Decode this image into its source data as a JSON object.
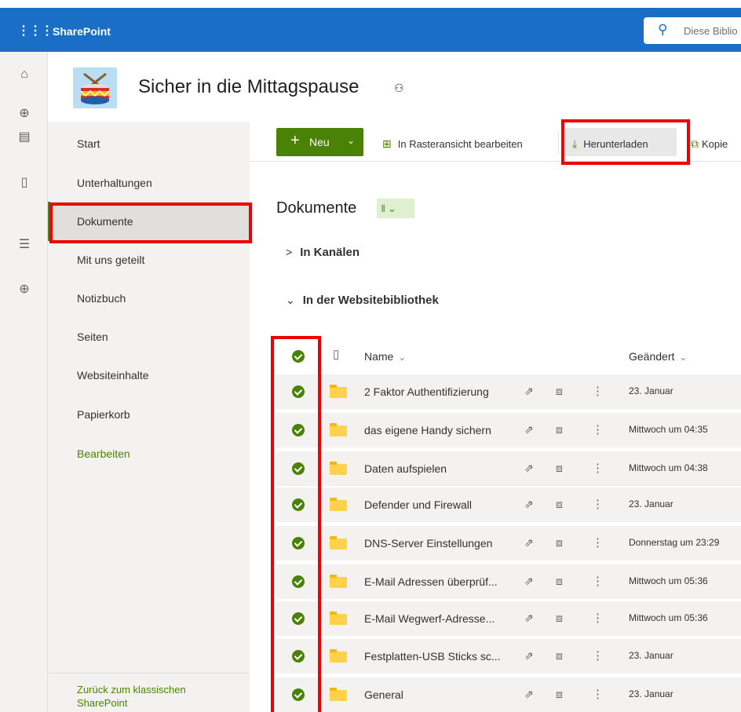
{
  "topbar": {
    "app_launcher_icon": "waffle-icon",
    "brand": "SharePoint",
    "search_placeholder": "Diese Biblio",
    "search_icon": "search-icon",
    "color": "#1a6ec6"
  },
  "rail": {
    "items": [
      "home-icon",
      "globe-icon",
      "news-icon",
      "file-icon",
      "list-icon",
      "add-icon"
    ]
  },
  "site": {
    "title": "Sicher in die Mittagspause",
    "teams_icon": "teams-icon"
  },
  "leftnav": {
    "items": [
      "Start",
      "Unterhaltungen",
      "Dokumente",
      "Mit uns geteilt",
      "Notizbuch",
      "Seiten",
      "Websiteinhalte",
      "Papierkorb"
    ],
    "active": "Dokumente",
    "edit": "Bearbeiten",
    "classic_link": "Zurück zum klassischen SharePoint"
  },
  "commandbar": {
    "new_label": "Neu",
    "grid_edit": "In Rasteransicht bearbeiten",
    "download": "Herunterladen",
    "copy": "Kopie",
    "accent": "#498205"
  },
  "library": {
    "title": "Dokumente",
    "sections": [
      "In Kanälen",
      "In der Websitebibliothek"
    ],
    "columns": {
      "name": "Name",
      "modified": "Geändert"
    },
    "rows": [
      {
        "name": "2 Faktor Authentifizierung",
        "modified": "23. Januar"
      },
      {
        "name": "das eigene Handy sichern",
        "modified": "Mittwoch um 04:35"
      },
      {
        "name": "Daten aufspielen",
        "modified": "Mittwoch um 04:38"
      },
      {
        "name": "Defender und Firewall",
        "modified": "23. Januar"
      },
      {
        "name": "DNS-Server Einstellungen",
        "modified": "Donnerstag um 23:29"
      },
      {
        "name": "E-Mail Adressen überprüf...",
        "modified": "Mittwoch um 05:36"
      },
      {
        "name": "E-Mail Wegwerf-Adresse...",
        "modified": "Mittwoch um 05:36"
      },
      {
        "name": "Festplatten-USB Sticks sc...",
        "modified": "23. Januar"
      },
      {
        "name": "General",
        "modified": "23. Januar"
      }
    ]
  },
  "highlight_color": "#ee0000"
}
